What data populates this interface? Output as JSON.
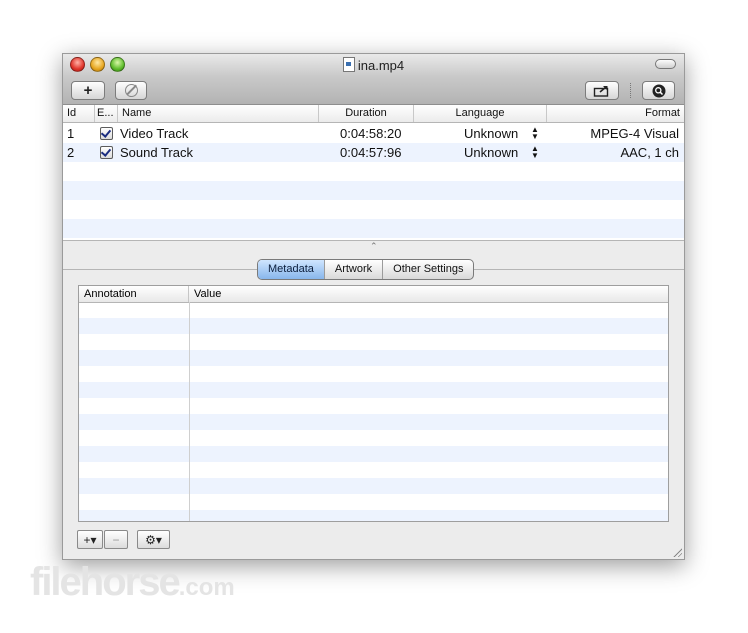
{
  "window": {
    "title": "ina.mp4"
  },
  "toolbar": {
    "add_label": "+"
  },
  "tracks": {
    "columns": [
      "Id",
      "E...",
      "Name",
      "Duration",
      "Language",
      "Format"
    ],
    "rows": [
      {
        "id": "1",
        "enabled": true,
        "name": "Video Track",
        "duration": "0:04:58:20",
        "language": "Unknown",
        "format": "MPEG-4 Visual"
      },
      {
        "id": "2",
        "enabled": true,
        "name": "Sound Track",
        "duration": "0:04:57:96",
        "language": "Unknown",
        "format": "AAC, 1 ch"
      }
    ]
  },
  "tabs": [
    {
      "label": "Metadata",
      "active": true
    },
    {
      "label": "Artwork",
      "active": false
    },
    {
      "label": "Other Settings",
      "active": false
    }
  ],
  "metadata": {
    "columns": [
      "Annotation",
      "Value"
    ],
    "rows": []
  },
  "bottom_bar": {
    "add_label": "+▾",
    "remove_label": "−",
    "gear_label": "⚙▾"
  },
  "watermark": {
    "text": "filehorse",
    "suffix": ".com"
  },
  "colors": {
    "row_alt": "#edf3fe",
    "tab_active": "#88b6ec"
  }
}
